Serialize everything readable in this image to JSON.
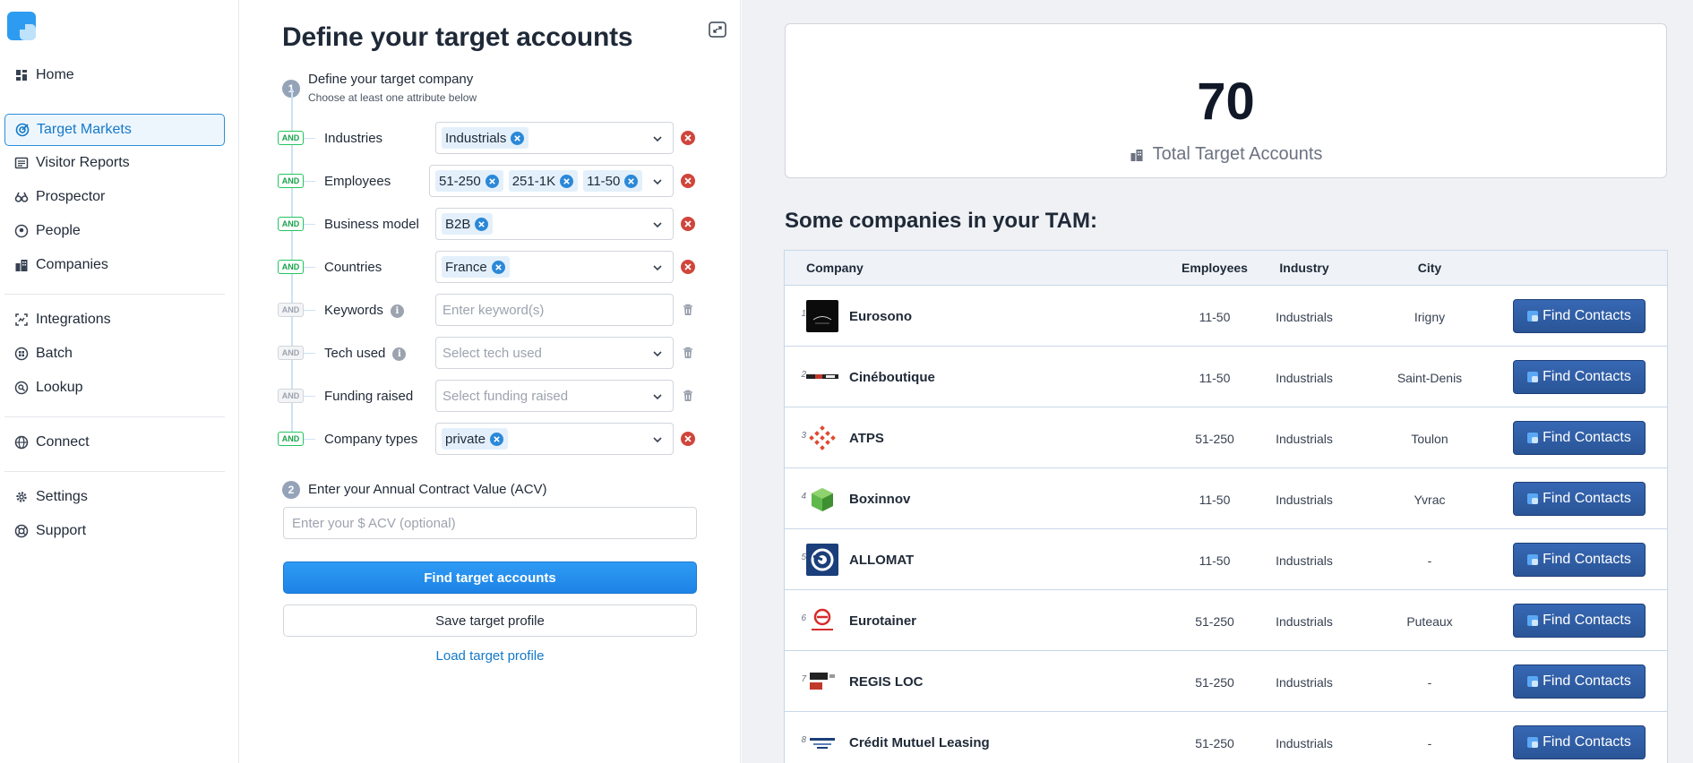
{
  "sidebar": {
    "items": [
      {
        "label": "Home",
        "icon": "home-icon"
      },
      {
        "label": "Target Markets",
        "icon": "target-icon",
        "active": true
      },
      {
        "label": "Visitor Reports",
        "icon": "report-icon"
      },
      {
        "label": "Prospector",
        "icon": "binoculars-icon"
      },
      {
        "label": "People",
        "icon": "person-icon"
      },
      {
        "label": "Companies",
        "icon": "buildings-icon"
      },
      {
        "label": "Integrations",
        "icon": "integrations-icon"
      },
      {
        "label": "Batch",
        "icon": "batch-icon"
      },
      {
        "label": "Lookup",
        "icon": "lookup-icon"
      },
      {
        "label": "Connect",
        "icon": "globe-icon"
      },
      {
        "label": "Settings",
        "icon": "gear-icon"
      },
      {
        "label": "Support",
        "icon": "support-icon"
      }
    ]
  },
  "builder": {
    "title": "Define your target accounts",
    "step1": {
      "number": "1",
      "title": "Define your target company",
      "subtitle": "Choose at least one attribute below"
    },
    "filters": [
      {
        "and": "AND",
        "label": "Industries",
        "chips": [
          "Industrials"
        ]
      },
      {
        "and": "AND",
        "label": "Employees",
        "chips": [
          "51-250",
          "251-1K",
          "11-50"
        ]
      },
      {
        "and": "AND",
        "label": "Business model",
        "chips": [
          "B2B"
        ]
      },
      {
        "and": "AND",
        "label": "Countries",
        "chips": [
          "France"
        ]
      },
      {
        "and": "AND",
        "label": "Keywords",
        "placeholder": "Enter keyword(s)"
      },
      {
        "and": "AND",
        "label": "Tech used",
        "placeholder": "Select tech used"
      },
      {
        "and": "AND",
        "label": "Funding raised",
        "placeholder": "Select funding raised"
      },
      {
        "and": "AND",
        "label": "Company types",
        "chips": [
          "private"
        ]
      }
    ],
    "step2": {
      "number": "2",
      "title": "Enter your Annual Contract Value (ACV)"
    },
    "acv_placeholder": "Enter your $ ACV (optional)",
    "find_button": "Find target accounts",
    "save_button": "Save target profile",
    "load_link": "Load target profile"
  },
  "summary": {
    "total": "70",
    "total_label": "Total Target Accounts",
    "list_title": "Some companies in your TAM:"
  },
  "table": {
    "headers": {
      "company": "Company",
      "employees": "Employees",
      "industry": "Industry",
      "city": "City"
    },
    "find_label": "Find Contacts",
    "rows": [
      {
        "index": "1",
        "name": "Eurosono",
        "employees": "11-50",
        "industry": "Industrials",
        "city": "Irigny"
      },
      {
        "index": "2",
        "name": "Cinéboutique",
        "employees": "11-50",
        "industry": "Industrials",
        "city": "Saint-Denis"
      },
      {
        "index": "3",
        "name": "ATPS",
        "employees": "51-250",
        "industry": "Industrials",
        "city": "Toulon"
      },
      {
        "index": "4",
        "name": "Boxinnov",
        "employees": "11-50",
        "industry": "Industrials",
        "city": "Yvrac"
      },
      {
        "index": "5",
        "name": "ALLOMAT",
        "employees": "11-50",
        "industry": "Industrials",
        "city": "-"
      },
      {
        "index": "6",
        "name": "Eurotainer",
        "employees": "51-250",
        "industry": "Industrials",
        "city": "Puteaux"
      },
      {
        "index": "7",
        "name": "REGIS LOC",
        "employees": "51-250",
        "industry": "Industrials",
        "city": "-"
      },
      {
        "index": "8",
        "name": "Crédit Mutuel Leasing",
        "employees": "51-250",
        "industry": "Industrials",
        "city": "-"
      }
    ]
  },
  "colors": {
    "accent": "#1d83e6",
    "button_dark": "#2a5597",
    "remove": "#d0453b"
  }
}
